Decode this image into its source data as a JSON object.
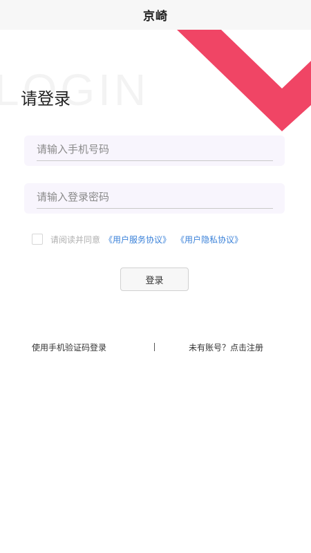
{
  "header": {
    "title": "京崎"
  },
  "background_word": "LOGIN",
  "page_title": "请登录",
  "form": {
    "phone_placeholder": "请输入手机号码",
    "password_placeholder": "请输入登录密码",
    "agreement_prefix": "请阅读并同意",
    "service_agreement": "《用户服务协议》",
    "privacy_agreement": "《用户隐私协议》",
    "agreement_checked": false,
    "login_label": "登录"
  },
  "footer": {
    "sms_login": "使用手机验证码登录",
    "register": "未有账号？点击注册"
  },
  "colors": {
    "accent": "#f04565",
    "link": "#3b82d9",
    "field_bg": "#f8f5fd"
  }
}
